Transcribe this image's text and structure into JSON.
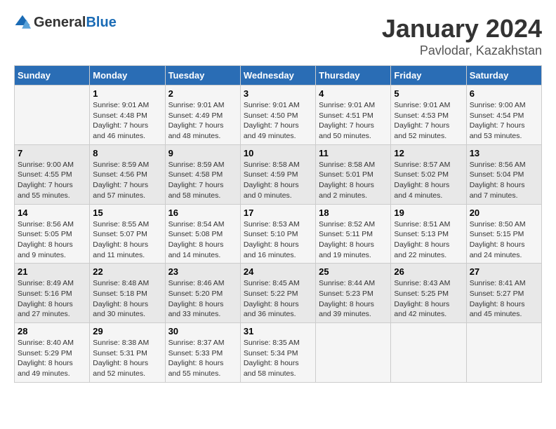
{
  "logo": {
    "general": "General",
    "blue": "Blue"
  },
  "title": {
    "month": "January 2024",
    "location": "Pavlodar, Kazakhstan"
  },
  "days_of_week": [
    "Sunday",
    "Monday",
    "Tuesday",
    "Wednesday",
    "Thursday",
    "Friday",
    "Saturday"
  ],
  "weeks": [
    [
      {
        "day": "",
        "sunrise": "",
        "sunset": "",
        "daylight": ""
      },
      {
        "day": "1",
        "sunrise": "Sunrise: 9:01 AM",
        "sunset": "Sunset: 4:48 PM",
        "daylight": "Daylight: 7 hours and 46 minutes."
      },
      {
        "day": "2",
        "sunrise": "Sunrise: 9:01 AM",
        "sunset": "Sunset: 4:49 PM",
        "daylight": "Daylight: 7 hours and 48 minutes."
      },
      {
        "day": "3",
        "sunrise": "Sunrise: 9:01 AM",
        "sunset": "Sunset: 4:50 PM",
        "daylight": "Daylight: 7 hours and 49 minutes."
      },
      {
        "day": "4",
        "sunrise": "Sunrise: 9:01 AM",
        "sunset": "Sunset: 4:51 PM",
        "daylight": "Daylight: 7 hours and 50 minutes."
      },
      {
        "day": "5",
        "sunrise": "Sunrise: 9:01 AM",
        "sunset": "Sunset: 4:53 PM",
        "daylight": "Daylight: 7 hours and 52 minutes."
      },
      {
        "day": "6",
        "sunrise": "Sunrise: 9:00 AM",
        "sunset": "Sunset: 4:54 PM",
        "daylight": "Daylight: 7 hours and 53 minutes."
      }
    ],
    [
      {
        "day": "7",
        "sunrise": "Sunrise: 9:00 AM",
        "sunset": "Sunset: 4:55 PM",
        "daylight": "Daylight: 7 hours and 55 minutes."
      },
      {
        "day": "8",
        "sunrise": "Sunrise: 8:59 AM",
        "sunset": "Sunset: 4:56 PM",
        "daylight": "Daylight: 7 hours and 57 minutes."
      },
      {
        "day": "9",
        "sunrise": "Sunrise: 8:59 AM",
        "sunset": "Sunset: 4:58 PM",
        "daylight": "Daylight: 7 hours and 58 minutes."
      },
      {
        "day": "10",
        "sunrise": "Sunrise: 8:58 AM",
        "sunset": "Sunset: 4:59 PM",
        "daylight": "Daylight: 8 hours and 0 minutes."
      },
      {
        "day": "11",
        "sunrise": "Sunrise: 8:58 AM",
        "sunset": "Sunset: 5:01 PM",
        "daylight": "Daylight: 8 hours and 2 minutes."
      },
      {
        "day": "12",
        "sunrise": "Sunrise: 8:57 AM",
        "sunset": "Sunset: 5:02 PM",
        "daylight": "Daylight: 8 hours and 4 minutes."
      },
      {
        "day": "13",
        "sunrise": "Sunrise: 8:56 AM",
        "sunset": "Sunset: 5:04 PM",
        "daylight": "Daylight: 8 hours and 7 minutes."
      }
    ],
    [
      {
        "day": "14",
        "sunrise": "Sunrise: 8:56 AM",
        "sunset": "Sunset: 5:05 PM",
        "daylight": "Daylight: 8 hours and 9 minutes."
      },
      {
        "day": "15",
        "sunrise": "Sunrise: 8:55 AM",
        "sunset": "Sunset: 5:07 PM",
        "daylight": "Daylight: 8 hours and 11 minutes."
      },
      {
        "day": "16",
        "sunrise": "Sunrise: 8:54 AM",
        "sunset": "Sunset: 5:08 PM",
        "daylight": "Daylight: 8 hours and 14 minutes."
      },
      {
        "day": "17",
        "sunrise": "Sunrise: 8:53 AM",
        "sunset": "Sunset: 5:10 PM",
        "daylight": "Daylight: 8 hours and 16 minutes."
      },
      {
        "day": "18",
        "sunrise": "Sunrise: 8:52 AM",
        "sunset": "Sunset: 5:11 PM",
        "daylight": "Daylight: 8 hours and 19 minutes."
      },
      {
        "day": "19",
        "sunrise": "Sunrise: 8:51 AM",
        "sunset": "Sunset: 5:13 PM",
        "daylight": "Daylight: 8 hours and 22 minutes."
      },
      {
        "day": "20",
        "sunrise": "Sunrise: 8:50 AM",
        "sunset": "Sunset: 5:15 PM",
        "daylight": "Daylight: 8 hours and 24 minutes."
      }
    ],
    [
      {
        "day": "21",
        "sunrise": "Sunrise: 8:49 AM",
        "sunset": "Sunset: 5:16 PM",
        "daylight": "Daylight: 8 hours and 27 minutes."
      },
      {
        "day": "22",
        "sunrise": "Sunrise: 8:48 AM",
        "sunset": "Sunset: 5:18 PM",
        "daylight": "Daylight: 8 hours and 30 minutes."
      },
      {
        "day": "23",
        "sunrise": "Sunrise: 8:46 AM",
        "sunset": "Sunset: 5:20 PM",
        "daylight": "Daylight: 8 hours and 33 minutes."
      },
      {
        "day": "24",
        "sunrise": "Sunrise: 8:45 AM",
        "sunset": "Sunset: 5:22 PM",
        "daylight": "Daylight: 8 hours and 36 minutes."
      },
      {
        "day": "25",
        "sunrise": "Sunrise: 8:44 AM",
        "sunset": "Sunset: 5:23 PM",
        "daylight": "Daylight: 8 hours and 39 minutes."
      },
      {
        "day": "26",
        "sunrise": "Sunrise: 8:43 AM",
        "sunset": "Sunset: 5:25 PM",
        "daylight": "Daylight: 8 hours and 42 minutes."
      },
      {
        "day": "27",
        "sunrise": "Sunrise: 8:41 AM",
        "sunset": "Sunset: 5:27 PM",
        "daylight": "Daylight: 8 hours and 45 minutes."
      }
    ],
    [
      {
        "day": "28",
        "sunrise": "Sunrise: 8:40 AM",
        "sunset": "Sunset: 5:29 PM",
        "daylight": "Daylight: 8 hours and 49 minutes."
      },
      {
        "day": "29",
        "sunrise": "Sunrise: 8:38 AM",
        "sunset": "Sunset: 5:31 PM",
        "daylight": "Daylight: 8 hours and 52 minutes."
      },
      {
        "day": "30",
        "sunrise": "Sunrise: 8:37 AM",
        "sunset": "Sunset: 5:33 PM",
        "daylight": "Daylight: 8 hours and 55 minutes."
      },
      {
        "day": "31",
        "sunrise": "Sunrise: 8:35 AM",
        "sunset": "Sunset: 5:34 PM",
        "daylight": "Daylight: 8 hours and 58 minutes."
      },
      {
        "day": "",
        "sunrise": "",
        "sunset": "",
        "daylight": ""
      },
      {
        "day": "",
        "sunrise": "",
        "sunset": "",
        "daylight": ""
      },
      {
        "day": "",
        "sunrise": "",
        "sunset": "",
        "daylight": ""
      }
    ]
  ]
}
